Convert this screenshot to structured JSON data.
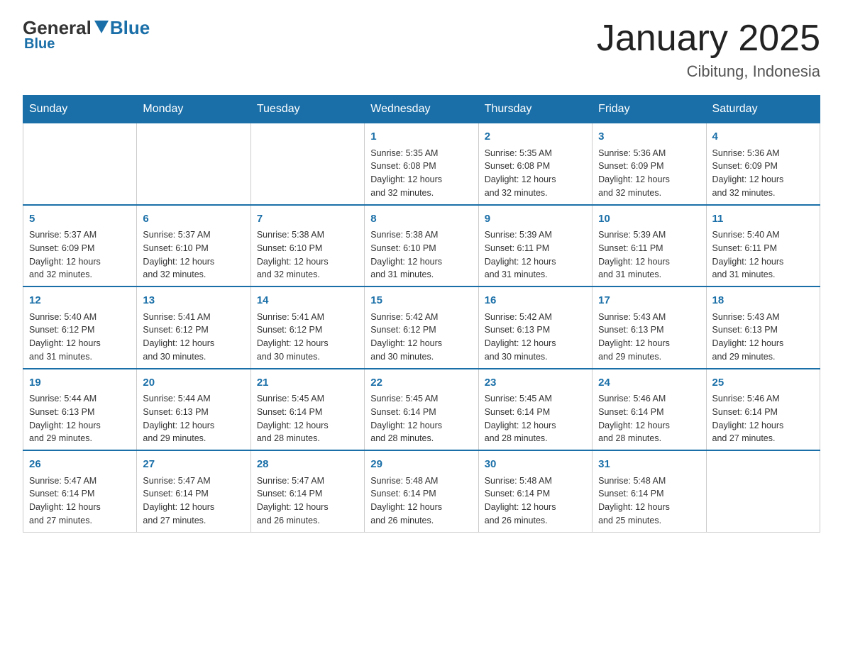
{
  "header": {
    "logo_general": "General",
    "logo_blue": "Blue",
    "main_title": "January 2025",
    "subtitle": "Cibitung, Indonesia"
  },
  "columns": [
    "Sunday",
    "Monday",
    "Tuesday",
    "Wednesday",
    "Thursday",
    "Friday",
    "Saturday"
  ],
  "weeks": [
    [
      {
        "num": "",
        "info": ""
      },
      {
        "num": "",
        "info": ""
      },
      {
        "num": "",
        "info": ""
      },
      {
        "num": "1",
        "info": "Sunrise: 5:35 AM\nSunset: 6:08 PM\nDaylight: 12 hours\nand 32 minutes."
      },
      {
        "num": "2",
        "info": "Sunrise: 5:35 AM\nSunset: 6:08 PM\nDaylight: 12 hours\nand 32 minutes."
      },
      {
        "num": "3",
        "info": "Sunrise: 5:36 AM\nSunset: 6:09 PM\nDaylight: 12 hours\nand 32 minutes."
      },
      {
        "num": "4",
        "info": "Sunrise: 5:36 AM\nSunset: 6:09 PM\nDaylight: 12 hours\nand 32 minutes."
      }
    ],
    [
      {
        "num": "5",
        "info": "Sunrise: 5:37 AM\nSunset: 6:09 PM\nDaylight: 12 hours\nand 32 minutes."
      },
      {
        "num": "6",
        "info": "Sunrise: 5:37 AM\nSunset: 6:10 PM\nDaylight: 12 hours\nand 32 minutes."
      },
      {
        "num": "7",
        "info": "Sunrise: 5:38 AM\nSunset: 6:10 PM\nDaylight: 12 hours\nand 32 minutes."
      },
      {
        "num": "8",
        "info": "Sunrise: 5:38 AM\nSunset: 6:10 PM\nDaylight: 12 hours\nand 31 minutes."
      },
      {
        "num": "9",
        "info": "Sunrise: 5:39 AM\nSunset: 6:11 PM\nDaylight: 12 hours\nand 31 minutes."
      },
      {
        "num": "10",
        "info": "Sunrise: 5:39 AM\nSunset: 6:11 PM\nDaylight: 12 hours\nand 31 minutes."
      },
      {
        "num": "11",
        "info": "Sunrise: 5:40 AM\nSunset: 6:11 PM\nDaylight: 12 hours\nand 31 minutes."
      }
    ],
    [
      {
        "num": "12",
        "info": "Sunrise: 5:40 AM\nSunset: 6:12 PM\nDaylight: 12 hours\nand 31 minutes."
      },
      {
        "num": "13",
        "info": "Sunrise: 5:41 AM\nSunset: 6:12 PM\nDaylight: 12 hours\nand 30 minutes."
      },
      {
        "num": "14",
        "info": "Sunrise: 5:41 AM\nSunset: 6:12 PM\nDaylight: 12 hours\nand 30 minutes."
      },
      {
        "num": "15",
        "info": "Sunrise: 5:42 AM\nSunset: 6:12 PM\nDaylight: 12 hours\nand 30 minutes."
      },
      {
        "num": "16",
        "info": "Sunrise: 5:42 AM\nSunset: 6:13 PM\nDaylight: 12 hours\nand 30 minutes."
      },
      {
        "num": "17",
        "info": "Sunrise: 5:43 AM\nSunset: 6:13 PM\nDaylight: 12 hours\nand 29 minutes."
      },
      {
        "num": "18",
        "info": "Sunrise: 5:43 AM\nSunset: 6:13 PM\nDaylight: 12 hours\nand 29 minutes."
      }
    ],
    [
      {
        "num": "19",
        "info": "Sunrise: 5:44 AM\nSunset: 6:13 PM\nDaylight: 12 hours\nand 29 minutes."
      },
      {
        "num": "20",
        "info": "Sunrise: 5:44 AM\nSunset: 6:13 PM\nDaylight: 12 hours\nand 29 minutes."
      },
      {
        "num": "21",
        "info": "Sunrise: 5:45 AM\nSunset: 6:14 PM\nDaylight: 12 hours\nand 28 minutes."
      },
      {
        "num": "22",
        "info": "Sunrise: 5:45 AM\nSunset: 6:14 PM\nDaylight: 12 hours\nand 28 minutes."
      },
      {
        "num": "23",
        "info": "Sunrise: 5:45 AM\nSunset: 6:14 PM\nDaylight: 12 hours\nand 28 minutes."
      },
      {
        "num": "24",
        "info": "Sunrise: 5:46 AM\nSunset: 6:14 PM\nDaylight: 12 hours\nand 28 minutes."
      },
      {
        "num": "25",
        "info": "Sunrise: 5:46 AM\nSunset: 6:14 PM\nDaylight: 12 hours\nand 27 minutes."
      }
    ],
    [
      {
        "num": "26",
        "info": "Sunrise: 5:47 AM\nSunset: 6:14 PM\nDaylight: 12 hours\nand 27 minutes."
      },
      {
        "num": "27",
        "info": "Sunrise: 5:47 AM\nSunset: 6:14 PM\nDaylight: 12 hours\nand 27 minutes."
      },
      {
        "num": "28",
        "info": "Sunrise: 5:47 AM\nSunset: 6:14 PM\nDaylight: 12 hours\nand 26 minutes."
      },
      {
        "num": "29",
        "info": "Sunrise: 5:48 AM\nSunset: 6:14 PM\nDaylight: 12 hours\nand 26 minutes."
      },
      {
        "num": "30",
        "info": "Sunrise: 5:48 AM\nSunset: 6:14 PM\nDaylight: 12 hours\nand 26 minutes."
      },
      {
        "num": "31",
        "info": "Sunrise: 5:48 AM\nSunset: 6:14 PM\nDaylight: 12 hours\nand 25 minutes."
      },
      {
        "num": "",
        "info": ""
      }
    ]
  ]
}
